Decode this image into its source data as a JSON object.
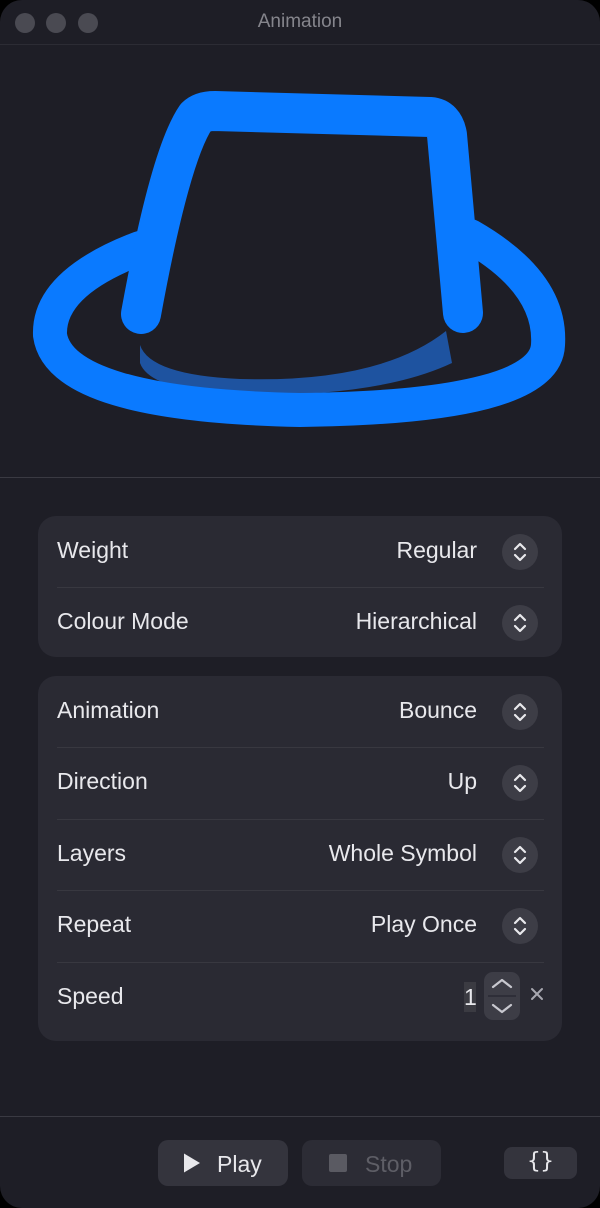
{
  "window": {
    "title": "Animation"
  },
  "preview": {
    "symbol_icon": "hat-icon",
    "primary_color": "#0a7aff",
    "secondary_color": "#1e53a0"
  },
  "appearance": {
    "rows": [
      {
        "label": "Weight",
        "value": "Regular"
      },
      {
        "label": "Colour Mode",
        "value": "Hierarchical"
      }
    ]
  },
  "animation": {
    "rows": [
      {
        "label": "Animation",
        "value": "Bounce"
      },
      {
        "label": "Direction",
        "value": "Up"
      },
      {
        "label": "Layers",
        "value": "Whole Symbol"
      },
      {
        "label": "Repeat",
        "value": "Play Once"
      }
    ],
    "speed": {
      "label": "Speed",
      "value": "1",
      "unit_icon": "multiply-icon"
    }
  },
  "footer": {
    "play_label": "Play",
    "stop_label": "Stop",
    "code_label": "{}"
  }
}
